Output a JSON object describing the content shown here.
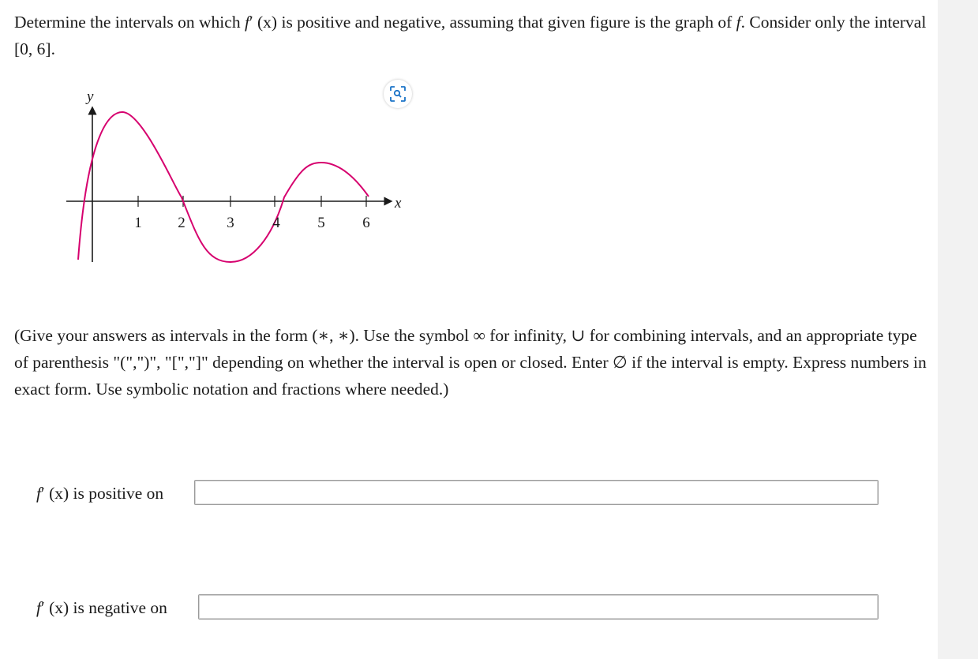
{
  "question": {
    "text_1": "Determine the intervals on which ",
    "fprime_f": "f",
    "fprime_prime": "′",
    "fprime_arg": " (x)",
    "text_2": " is positive and negative, assuming that given figure is the graph of ",
    "f_symbol": "f",
    "text_3": ". Consider only the interval ",
    "interval": "[0, 6]",
    "text_4": "."
  },
  "figure": {
    "y_label": "y",
    "x_label": "x",
    "tick_labels": [
      "1",
      "2",
      "3",
      "4",
      "5",
      "6"
    ],
    "curve_color": "#d6006e",
    "zoom_icon": "zoom-icon"
  },
  "instructions": {
    "part_1": "(Give your answers as intervals in the form ",
    "form": "(∗, ∗)",
    "part_2": ". Use the symbol ",
    "infinity": "∞",
    "part_3": " for infinity, ",
    "union": "∪",
    "part_4": " for combining intervals, and an appropriate type of parenthesis \"(\",\")\", \"[\",\"]\" depending on whether the interval is open or closed. Enter ",
    "empty": "∅",
    "part_5": " if the interval is empty. Express numbers in exact form. Use symbolic notation and fractions where needed.)"
  },
  "answers": {
    "positive_f": "f",
    "positive_prime": "′",
    "positive_arg": " (x)",
    "positive_label": " is positive on",
    "positive_value": "",
    "negative_f": "f",
    "negative_prime": "′",
    "negative_arg": " (x)",
    "negative_label": " is negative on",
    "negative_value": ""
  }
}
